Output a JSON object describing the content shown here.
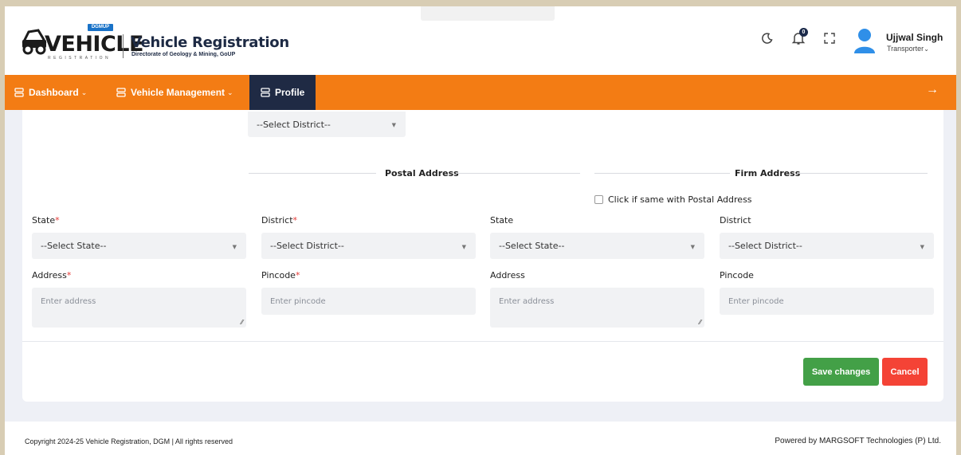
{
  "header": {
    "logo_badge": "DGMUP",
    "logo_word": "VEHICLE",
    "logo_sub": "REGISTRATION",
    "app_title": "Vehicle Registration",
    "app_subtitle": "Directorate of Geology & Mining, GoUP",
    "notification_count": "0",
    "user_name": "Ujjwal Singh",
    "user_role": "Transporter",
    "icons": [
      "moon-icon",
      "bell-icon",
      "fullscreen-icon",
      "user-avatar-icon"
    ]
  },
  "nav": {
    "items": [
      {
        "label": "Dashboard",
        "icon": "server-icon",
        "chevron": true
      },
      {
        "label": "Vehicle Management",
        "icon": "server-icon",
        "chevron": true
      },
      {
        "label": "Profile",
        "icon": "server-icon",
        "chevron": false,
        "active": true
      }
    ],
    "arrow_icon": "arrow-right-icon"
  },
  "form": {
    "top_select_value": "--Select District--",
    "postal_title": "Postal Address",
    "firm_title": "Firm Address",
    "same_address_label": "Click if same with Postal Address",
    "postal": {
      "state_label": "State",
      "state_value": "--Select State--",
      "district_label": "District",
      "district_value": "--Select District--",
      "address_label": "Address",
      "address_placeholder": "Enter address",
      "pincode_label": "Pincode",
      "pincode_placeholder": "Enter pincode",
      "required_mark": "*"
    },
    "firm": {
      "state_label": "State",
      "state_value": "--Select State--",
      "district_label": "District",
      "district_value": "--Select District--",
      "address_label": "Address",
      "address_placeholder": "Enter address",
      "pincode_label": "Pincode",
      "pincode_placeholder": "Enter pincode"
    },
    "save_label": "Save changes",
    "cancel_label": "Cancel"
  },
  "footer": {
    "copyright": "Copyright 2024-25 Vehicle Registration, DGM | All rights reserved",
    "powered_by": "Powered by MARGSOFT Technologies (P) Ltd."
  },
  "colors": {
    "nav_bg": "#f37c14",
    "nav_active": "#1f2a44",
    "save_btn": "#43a047",
    "cancel_btn": "#f44336",
    "required": "#e53935"
  }
}
